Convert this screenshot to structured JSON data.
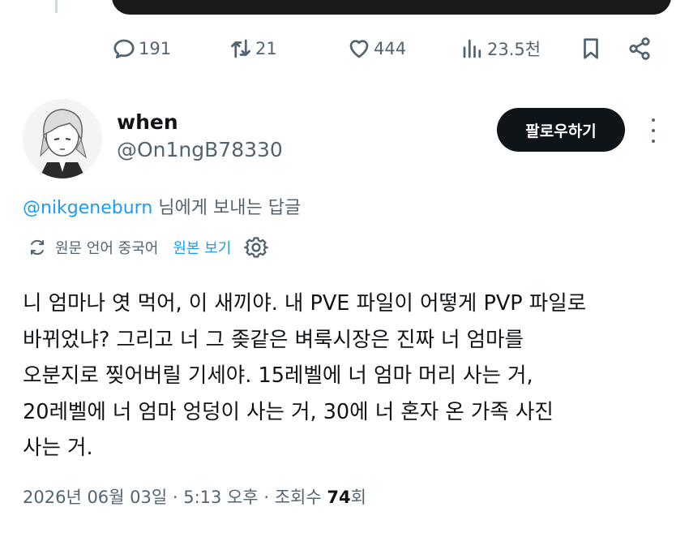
{
  "actions": {
    "replies": "191",
    "retweets": "21",
    "likes": "444",
    "views": "23.5천"
  },
  "author": {
    "name": "when",
    "handle": "@On1ngB78330",
    "follow_label": "팔로우하기"
  },
  "reply_context": {
    "mention": "@nikgeneburn",
    "suffix": "님에게 보내는 답글"
  },
  "translation": {
    "source_label": "원문 언어 중국어",
    "original_link": "원본 보기"
  },
  "post": {
    "lines": [
      "니 엄마나 엿 먹어, 이 새끼야. 내 PVE 파일이 어떻게 PVP 파일로",
      "바뀌었냐? 그리고 너 그 좆같은 벼룩시장은 진짜 너 엄마를",
      "오분지로 찢어버릴 기세야. 15레벨에 너 엄마 머리 사는 거,",
      "20레벨에 너 엄마 엉덩이 사는 거, 30에 너 혼자 온 가족 사진",
      "사는 거."
    ]
  },
  "meta": {
    "timestamp": "2026년 06월 03일 · 5:13 오후 · 조회수",
    "views_count": "74",
    "views_suffix": "회"
  }
}
